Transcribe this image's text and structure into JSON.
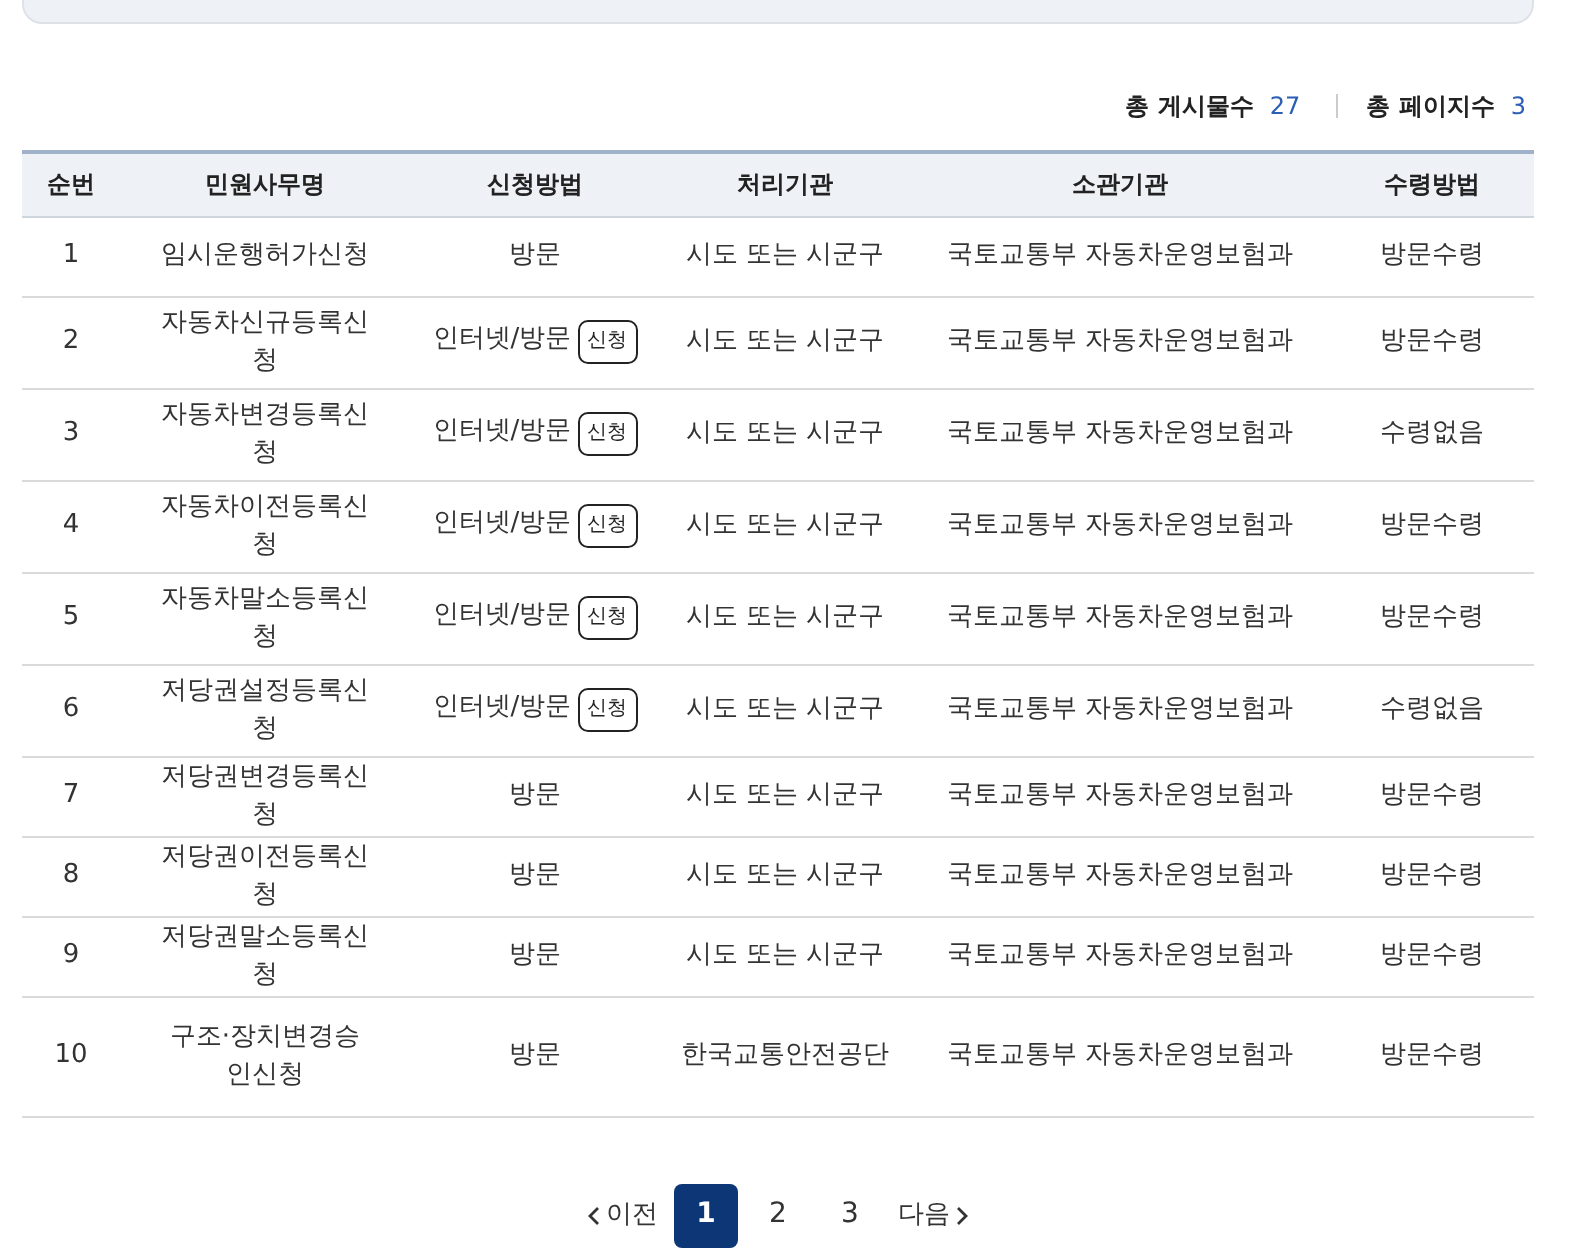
{
  "summary": [
    {
      "label": "총 게시물수",
      "value": "27"
    },
    {
      "label": "총 페이지수",
      "value": "3"
    }
  ],
  "table": {
    "columns": [
      "순번",
      "민원사무명",
      "신청방법",
      "처리기관",
      "소관기관",
      "수령방법"
    ],
    "rows": [
      {
        "no": "1",
        "name": "임시운행허가신청",
        "method": "방문",
        "apply_button": null,
        "agency": "시도 또는 시군구",
        "ministry": "국토교통부 자동차운영보험과",
        "receipt": "방문수령"
      },
      {
        "no": "2",
        "name": "자동차신규등록신청",
        "method": "인터넷/방문",
        "apply_button": "신청",
        "agency": "시도 또는 시군구",
        "ministry": "국토교통부 자동차운영보험과",
        "receipt": "방문수령"
      },
      {
        "no": "3",
        "name": "자동차변경등록신청",
        "method": "인터넷/방문",
        "apply_button": "신청",
        "agency": "시도 또는 시군구",
        "ministry": "국토교통부 자동차운영보험과",
        "receipt": "수령없음"
      },
      {
        "no": "4",
        "name": "자동차이전등록신청",
        "method": "인터넷/방문",
        "apply_button": "신청",
        "agency": "시도 또는 시군구",
        "ministry": "국토교통부 자동차운영보험과",
        "receipt": "방문수령"
      },
      {
        "no": "5",
        "name": "자동차말소등록신청",
        "method": "인터넷/방문",
        "apply_button": "신청",
        "agency": "시도 또는 시군구",
        "ministry": "국토교통부 자동차운영보험과",
        "receipt": "방문수령"
      },
      {
        "no": "6",
        "name": "저당권설정등록신청",
        "method": "인터넷/방문",
        "apply_button": "신청",
        "agency": "시도 또는 시군구",
        "ministry": "국토교통부 자동차운영보험과",
        "receipt": "수령없음"
      },
      {
        "no": "7",
        "name": "저당권변경등록신청",
        "method": "방문",
        "apply_button": null,
        "agency": "시도 또는 시군구",
        "ministry": "국토교통부 자동차운영보험과",
        "receipt": "방문수령"
      },
      {
        "no": "8",
        "name": "저당권이전등록신청",
        "method": "방문",
        "apply_button": null,
        "agency": "시도 또는 시군구",
        "ministry": "국토교통부 자동차운영보험과",
        "receipt": "방문수령"
      },
      {
        "no": "9",
        "name": "저당권말소등록신청",
        "method": "방문",
        "apply_button": null,
        "agency": "시도 또는 시군구",
        "ministry": "국토교통부 자동차운영보험과",
        "receipt": "방문수령"
      },
      {
        "no": "10",
        "name": "구조·장치변경승인신청",
        "method": "방문",
        "apply_button": null,
        "agency": "한국교통안전공단",
        "ministry": "국토교통부 자동차운영보험과",
        "receipt": "방문수령"
      }
    ]
  },
  "pagination": {
    "prev": "이전",
    "pages": [
      {
        "label": "1",
        "selected": true
      },
      {
        "label": "2",
        "selected": false
      },
      {
        "label": "3",
        "selected": false
      }
    ],
    "next": "다음"
  }
}
